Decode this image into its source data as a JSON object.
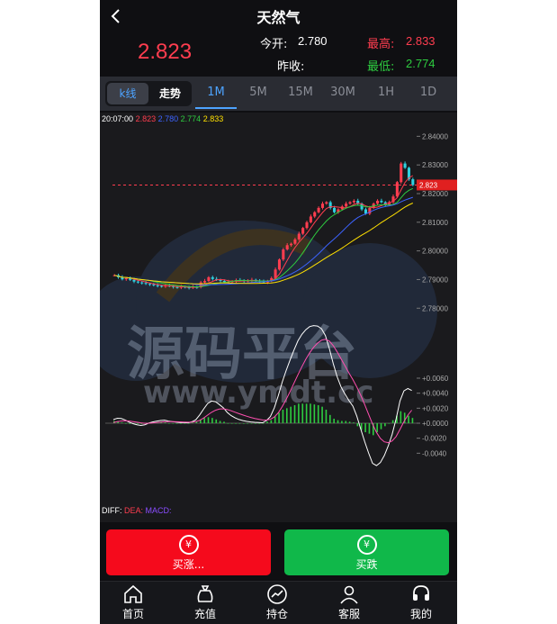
{
  "header": {
    "title": "天然气"
  },
  "quote": {
    "price": "2.823",
    "open_label": "今开:",
    "open_value": "2.780",
    "prev_close_label": "昨收:",
    "prev_close_value": "",
    "high_label": "最高:",
    "high_value": "2.833",
    "low_label": "最低:",
    "low_value": "2.774"
  },
  "chart_mode": {
    "kline": "k线",
    "trend": "走势"
  },
  "timeframes": [
    "1M",
    "5M",
    "15M",
    "30M",
    "1H",
    "1D"
  ],
  "active_timeframe": "1M",
  "chart_legend": {
    "time": "20:07:00",
    "v1": "2.823",
    "v2": "2.780",
    "v3": "2.774",
    "v4": "2.833"
  },
  "macd_legend": {
    "diff": "DIFF:",
    "dea": "DEA:",
    "macd": "MACD:"
  },
  "watermark": {
    "line1": "源码平台",
    "line2": "www.ymdt.cc"
  },
  "buttons": {
    "rise": "买涨...",
    "fall": "买跌",
    "currency_icon": "¥"
  },
  "tabbar": [
    {
      "label": "首页",
      "icon": "home-icon"
    },
    {
      "label": "充值",
      "icon": "money-bag-icon"
    },
    {
      "label": "持仓",
      "icon": "chart-line-icon"
    },
    {
      "label": "客服",
      "icon": "user-icon"
    },
    {
      "label": "我的",
      "icon": "headset-icon"
    }
  ],
  "colors": {
    "rise": "#f50a1c",
    "fall": "#10b84a",
    "accent": "#4da3ff",
    "ma1": "#ff3d4f",
    "ma2": "#3c63ff",
    "ma3": "#2ecc40",
    "ma4": "#ffe000"
  },
  "chart_data": {
    "type": "candlestick",
    "price_axis_ticks": [
      "2.84000",
      "2.83000",
      "2.82000",
      "2.81000",
      "2.80000",
      "2.79000",
      "2.78000"
    ],
    "price_range": [
      2.776,
      2.842
    ],
    "current_price_label": "2.823",
    "current_price": 2.823,
    "macd_axis_ticks": [
      "+0.0060",
      "+0.0040",
      "+0.0020",
      "+0.0000",
      "-0.0020",
      "-0.0040"
    ],
    "macd_range": [
      -0.0048,
      0.0066
    ],
    "closes": [
      2.7915,
      2.7908,
      2.7901,
      2.7905,
      2.7899,
      2.7893,
      2.789,
      2.7888,
      2.7885,
      2.7883,
      2.788,
      2.7878,
      2.7876,
      2.7879,
      2.7877,
      2.7874,
      2.7872,
      2.7875,
      2.7873,
      2.7871,
      2.7874,
      2.7873,
      2.789,
      2.7895,
      2.7908,
      2.7902,
      2.7899,
      2.7895,
      2.7891,
      2.7892,
      2.7894,
      2.7898,
      2.7897,
      2.7894,
      2.7896,
      2.7899,
      2.7896,
      2.7893,
      2.789,
      2.7895,
      2.7905,
      2.7935,
      2.797,
      2.8005,
      2.802,
      2.8025,
      2.804,
      2.806,
      2.808,
      2.81,
      2.812,
      2.8135,
      2.815,
      2.8165,
      2.817,
      2.815,
      2.8135,
      2.8145,
      2.8155,
      2.8165,
      2.817,
      2.8175,
      2.8165,
      2.8145,
      2.813,
      2.815,
      2.8165,
      2.8175,
      2.817,
      2.816,
      2.817,
      2.819,
      2.824,
      2.8305,
      2.829,
      2.825,
      2.823
    ],
    "macd_histogram": [
      0.0003,
      0.0002,
      0.0001,
      0.0,
      -0.0001,
      -0.0001,
      -0.0001,
      -0.0001,
      0.0,
      0.0001,
      0.0001,
      0.0001,
      0.0001,
      0.0001,
      0.0,
      0.0,
      0.0,
      0.0,
      0.0,
      0.0,
      0.0001,
      0.0002,
      0.0005,
      0.0007,
      0.0008,
      0.0007,
      0.0005,
      0.0003,
      0.0002,
      0.0,
      0.0,
      0.0,
      0.0,
      0.0,
      0.0,
      0.0,
      0.0,
      0.0,
      0.0,
      0.0002,
      0.0004,
      0.0009,
      0.0014,
      0.0018,
      0.002,
      0.0022,
      0.0024,
      0.0026,
      0.0026,
      0.0026,
      0.0026,
      0.0025,
      0.0024,
      0.0022,
      0.0018,
      0.0011,
      0.0006,
      0.0004,
      0.0003,
      0.0003,
      0.0002,
      0.0001,
      -0.0004,
      -0.0009,
      -0.0012,
      -0.0014,
      -0.0016,
      -0.0012,
      -0.0008,
      -0.0004,
      0.0,
      0.0004,
      0.001,
      0.0016,
      0.0014,
      0.001,
      0.0007
    ]
  }
}
